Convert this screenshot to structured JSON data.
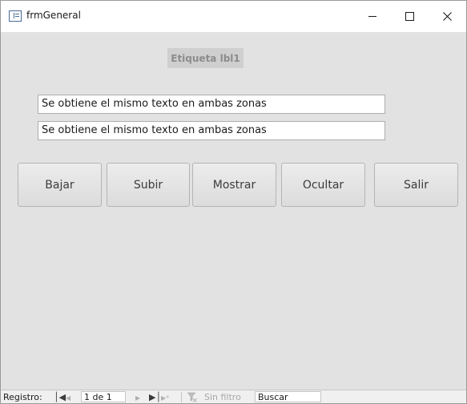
{
  "window": {
    "title": "frmGeneral"
  },
  "form": {
    "label": "Etiqueta lbl1",
    "textbox1_value": "Se obtiene el mismo texto en ambas zonas",
    "textbox2_value": "Se obtiene el mismo texto en ambas zonas",
    "buttons": {
      "bajar": "Bajar",
      "subir": "Subir",
      "mostrar": "Mostrar",
      "ocultar": "Ocultar",
      "salir": "Salir"
    }
  },
  "navigation": {
    "label": "Registro:",
    "record": "1 de 1",
    "filter": "Sin filtro",
    "search": "Buscar"
  },
  "colors": {
    "form_background": "#e2e2e2",
    "label_background": "#cfcfcf",
    "label_text": "#8c8c8c"
  },
  "icons": {
    "app": "form-icon",
    "minimize": "minimize-icon",
    "maximize": "maximize-icon",
    "close": "close-icon",
    "first": "first-record-icon",
    "prev": "previous-record-icon",
    "next": "next-record-icon",
    "last": "last-record-icon",
    "new": "new-record-icon",
    "filter": "filter-icon"
  }
}
